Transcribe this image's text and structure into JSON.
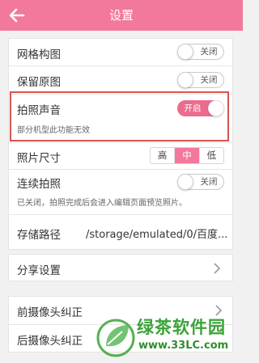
{
  "header": {
    "title": "设置"
  },
  "settings": {
    "grid": {
      "label": "网格构图",
      "state": "关闭"
    },
    "keep_original": {
      "label": "保留原图",
      "state": "关闭"
    },
    "shutter_sound": {
      "label": "拍照声音",
      "state": "开启",
      "note": "部分机型此功能无效"
    },
    "photo_size": {
      "label": "照片尺寸",
      "options": [
        "高",
        "中",
        "低"
      ],
      "selected": "中"
    },
    "burst": {
      "label": "连续拍照",
      "state": "关闭",
      "note": "已关闭，拍照完成后会进入编辑页面预览照片。"
    },
    "storage": {
      "label": "存储路径",
      "value": "/storage/emulated/0/百度..."
    }
  },
  "share": {
    "label": "分享设置"
  },
  "calibration": {
    "front": {
      "label": "前摄像头纠正"
    },
    "rear": {
      "label": "后摄像头纠正"
    }
  },
  "watermark": {
    "line1": "绿茶软件园",
    "line2": "www.33LC.com"
  },
  "colors": {
    "accent": "#f2789c",
    "toggle_on": "#ec6c8d",
    "highlight": "#d9534f",
    "watermark": "#3aa336"
  }
}
